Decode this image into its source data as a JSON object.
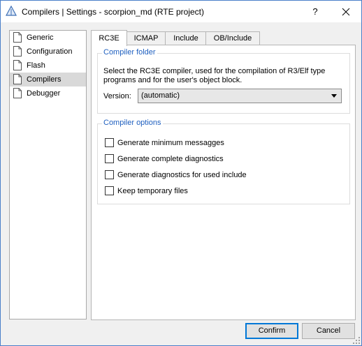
{
  "window": {
    "title": "Compilers | Settings - scorpion_md (RTE project)",
    "help_label": "?",
    "close_label": "✕"
  },
  "sidebar": {
    "items": [
      {
        "label": "Generic",
        "selected": false
      },
      {
        "label": "Configuration",
        "selected": false
      },
      {
        "label": "Flash",
        "selected": false
      },
      {
        "label": "Compilers",
        "selected": true
      },
      {
        "label": "Debugger",
        "selected": false
      }
    ]
  },
  "tabs": [
    {
      "label": "RC3E",
      "active": true
    },
    {
      "label": "ICMAP",
      "active": false
    },
    {
      "label": "Include",
      "active": false
    },
    {
      "label": "OB/Include",
      "active": false
    }
  ],
  "compiler_folder": {
    "title": "Compiler folder",
    "description": "Select the RC3E compiler, used for the compilation of R3/Elf type programs and for the user's object block.",
    "version_label": "Version:",
    "version_value": "(automatic)"
  },
  "compiler_options": {
    "title": "Compiler options",
    "options": [
      {
        "label": "Generate minimum messagges",
        "checked": false
      },
      {
        "label": "Generate complete diagnostics",
        "checked": false
      },
      {
        "label": "Generate diagnostics for used include",
        "checked": false
      },
      {
        "label": "Keep temporary files",
        "checked": false
      }
    ]
  },
  "buttons": {
    "confirm": "Confirm",
    "cancel": "Cancel"
  },
  "colors": {
    "group_title": "#1e5fbf",
    "selected_item": "#d9d9d9",
    "default_button_border": "#0078d7"
  }
}
